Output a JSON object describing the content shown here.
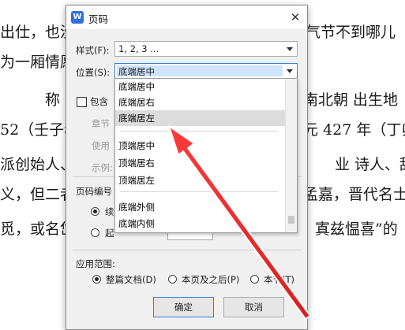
{
  "document": {
    "lines": [
      "出仕，也没见",
      "也气节不到哪儿",
      "为一厢情愿。",
      "称 陶潜",
      "南北朝 出生地",
      "52（壬子年",
      "元 427 年（丁卯",
      "派创始人、文",
      "业 诗人、辞",
      "义，但二者",
      "孟嘉，晋代名士",
      "觅，或名岱",
      "，寘兹愠喜”的"
    ]
  },
  "dialog": {
    "title": "页码",
    "app_icon_letter": "W",
    "close_glyph": "✕",
    "style_label": "样式(F):",
    "style_value": "1, 2, 3 ...",
    "position_label": "位置(S):",
    "position_value": "底端居中",
    "include_label": "包含",
    "chapter_label": "章节",
    "use_label": "使用",
    "example_label": "示例:",
    "numbering_label": "页码编号",
    "continue_label": "续",
    "start_label": "起",
    "scope_label": "应用范围:",
    "scope_options": [
      "整篇文档(D)",
      "本页及之后(P)",
      "本节(T)"
    ],
    "ok_label": "确定",
    "cancel_label": "取消"
  },
  "dropdown": {
    "items": [
      "底端居中",
      "底端居右",
      "底端居左",
      "顶端居中",
      "顶端居右",
      "顶端居左",
      "底端外侧",
      "底端内侧"
    ],
    "highlighted_index": 2
  },
  "colors": {
    "accent": "#3a7bd5",
    "selection": "#cfe3fb",
    "arrow": "#e5252a"
  }
}
